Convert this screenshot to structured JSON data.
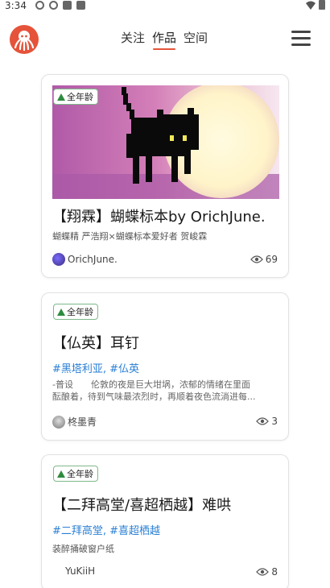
{
  "status": {
    "time": "3:34"
  },
  "header": {
    "tabs": [
      {
        "label": "关注",
        "active": false
      },
      {
        "label": "作品",
        "active": true
      },
      {
        "label": "空间",
        "active": false
      }
    ]
  },
  "accent_color": "#e5533a",
  "tag_color": "#2a7fd4",
  "works": [
    {
      "badge": "全年龄",
      "title": "【翔霖】蝴蝶标本by OrichJune.",
      "subtitle": "蝴蝶精 严浩翔×蝴蝶标本爱好者 贺峻霖",
      "author": "OrichJune.",
      "views": "69",
      "cover_icon": "pixel-black-cat"
    },
    {
      "badge": "全年龄",
      "title": "【仏英】耳钉",
      "tags": "#黑塔利亚, #仏英",
      "excerpt_line1": "-普设　　伦敦的夜是巨大坩埚，浓郁的情绪在里面",
      "excerpt_line2": "酝酿着，待到气味最浓烈时，再顺着夜色流淌进每...",
      "author": "柊墨青",
      "views": "3"
    },
    {
      "badge": "全年龄",
      "title": "【二拜高堂/喜超栖越】难哄",
      "tags": "#二拜高堂, #喜超栖越",
      "subtitle": "装醉捅破窗户纸",
      "author": "YuKiiH",
      "views": "8"
    }
  ]
}
